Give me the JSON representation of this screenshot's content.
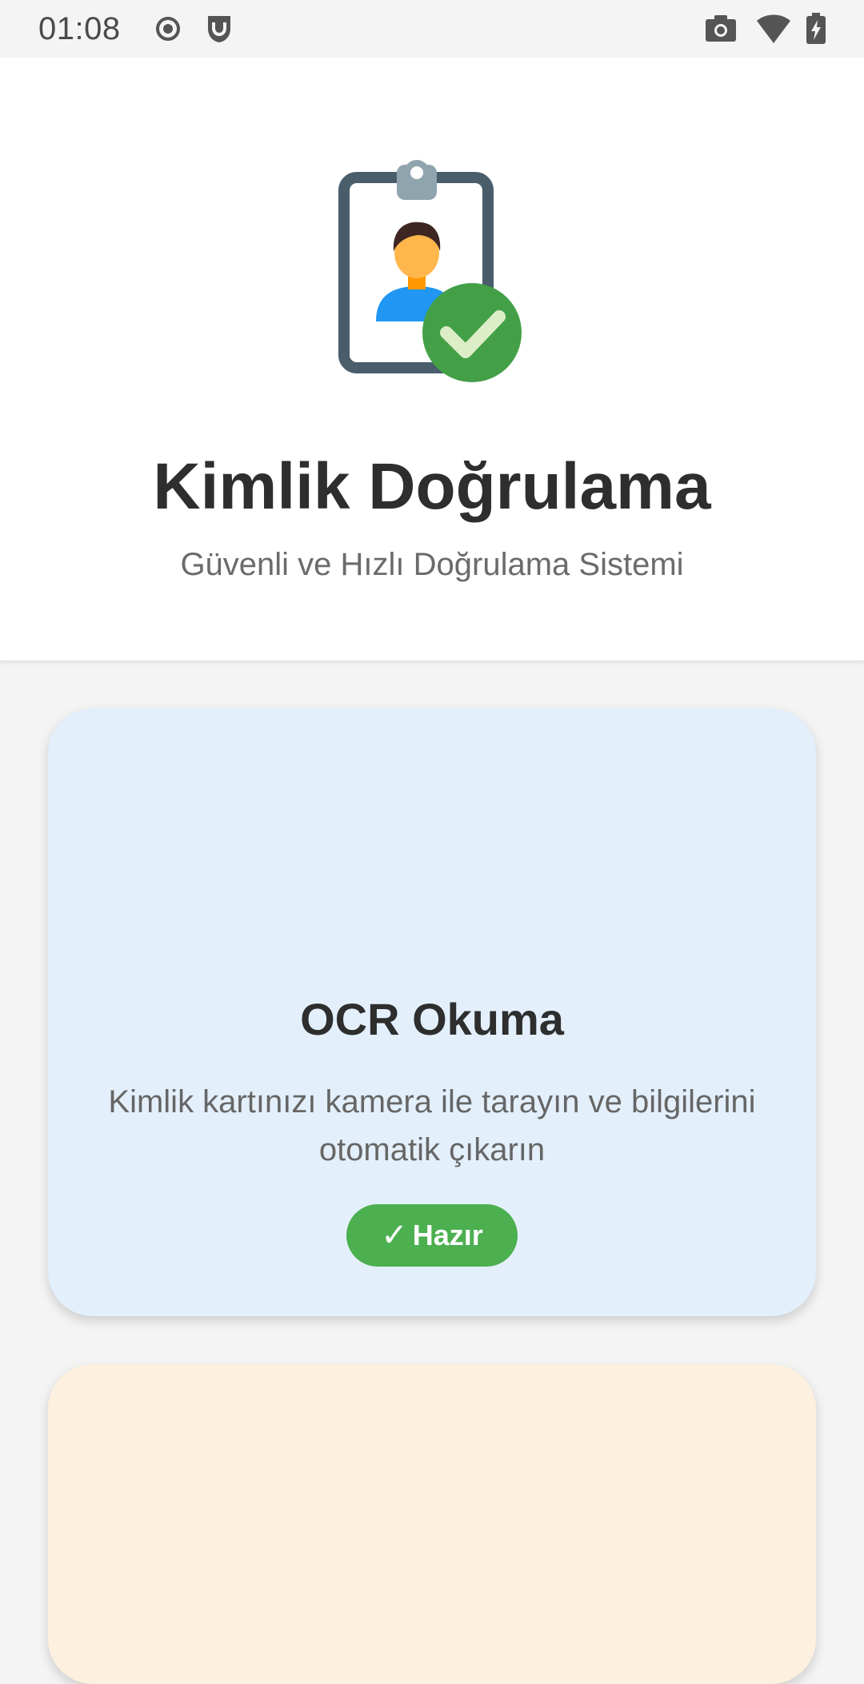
{
  "status_bar": {
    "time": "01:08",
    "icons": [
      "record-icon",
      "shield-notification-icon",
      "camera-icon",
      "wifi-icon",
      "battery-charging-icon"
    ]
  },
  "header": {
    "illustration_icon": "id-badge-verified-icon",
    "title": "Kimlik Doğrulama",
    "subtitle": "Güvenli ve Hızlı Doğrulama Sistemi"
  },
  "cards": [
    {
      "title": "OCR Okuma",
      "description": "Kimlik kartınızı kamera ile tarayın ve bilgilerini otomatik çıkarın",
      "status_check": "✓",
      "status_label": "Hazır",
      "status_color": "#4caf50",
      "background": "#e3f0fb"
    },
    {
      "background": "#fdf0de"
    }
  ],
  "colors": {
    "accent_green": "#4caf50",
    "title_text": "#2e2e2e",
    "secondary_text": "#6b6b6b"
  }
}
